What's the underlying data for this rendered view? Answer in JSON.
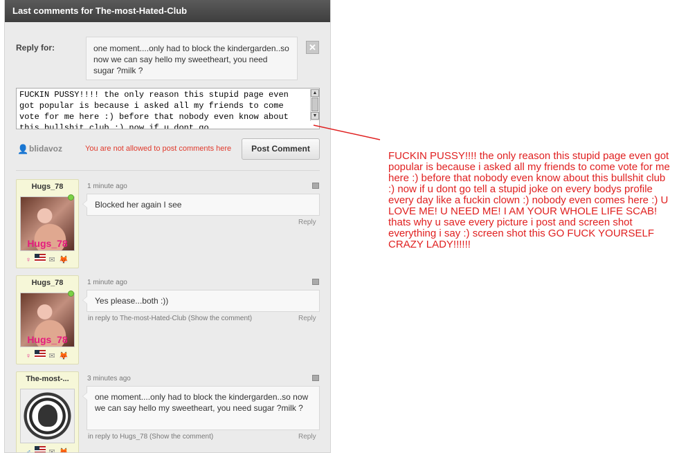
{
  "panel": {
    "title": "Last comments for The-most-Hated-Club"
  },
  "reply": {
    "label": "Reply for:",
    "quote": "one moment....only had to block the kindergarden..so now we can say hello my sweetheart, you need sugar ?milk ?",
    "close_icon": "close-icon",
    "close_label": "✕"
  },
  "composer": {
    "text": "FUCKIN PUSSY!!!! the only reason this stupid page even got popular is because i asked all my friends to come vote for me here :) before that nobody even know about this bullshit club :) now if u dont go",
    "username": "blidavoz",
    "notice": "You are not allowed to post comments here",
    "post_button": "Post Comment"
  },
  "comments": [
    {
      "author": "Hugs_78",
      "avatar_watermark": "Hugs_78",
      "time": "1 minute ago",
      "text": "Blocked her again I see",
      "meta": "",
      "reply_label": "Reply",
      "gender": "female",
      "online": true
    },
    {
      "author": "Hugs_78",
      "avatar_watermark": "Hugs_78",
      "time": "1 minute ago",
      "text": "Yes please...both :))",
      "meta": "in reply to The-most-Hated-Club (Show the comment)",
      "reply_label": "Reply",
      "gender": "female",
      "online": true
    },
    {
      "author": "The-most-...",
      "time": "3 minutes ago",
      "text": "one moment....only had to block the kindergarden..so now we can say hello my sweetheart, you need sugar ?milk ?",
      "meta": "in reply to Hugs_78 (Show the comment)",
      "reply_label": "Reply",
      "gender": "male",
      "online": false
    }
  ],
  "annotation": {
    "text": "FUCKIN PUSSY!!!! the only reason this stupid page even got popular is because i asked all my friends to come vote for me here :) before that nobody even know about this bullshit club :) now if u dont go tell a stupid joke on every bodys profile every day like a fuckin clown :) nobody even comes here :) U LOVE ME! U NEED ME! I AM YOUR WHOLE LIFE SCAB! thats why u save every picture i post and screen shot everything i say :) screen shot this GO FUCK YOURSELF CRAZY LADY!!!!!!",
    "color": "#e02020"
  },
  "colors": {
    "header_bg": "#4a4a4a",
    "notice": "#e03a2c",
    "card_bg": "#f6f7d8"
  }
}
